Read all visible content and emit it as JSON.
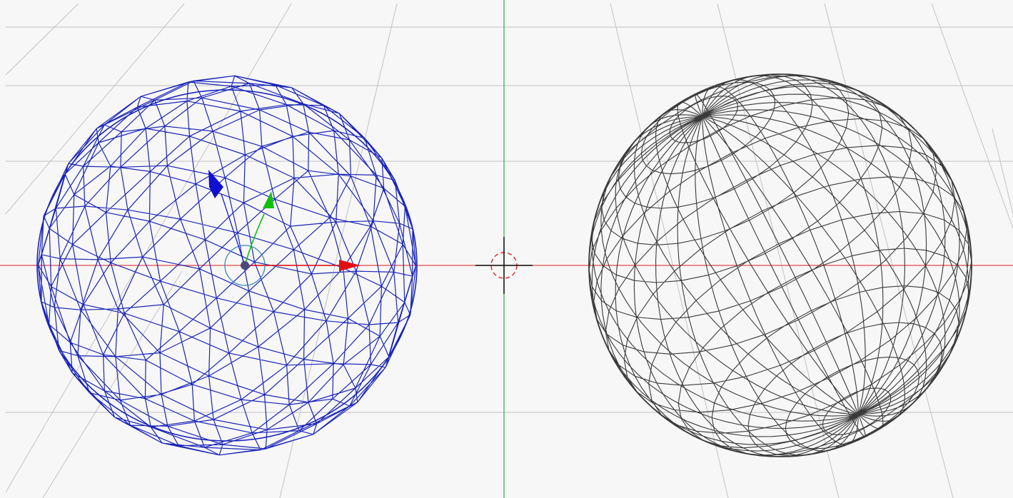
{
  "viewport": {
    "background": "#f7f7f7",
    "grid_color": "#c2c2c2",
    "grid_visible": true
  },
  "axes": {
    "x_axis_color": "#e04848",
    "y_axis_color": "#3cb84a"
  },
  "objects": [
    {
      "name": "icosphere",
      "mesh": "icosphere",
      "display": "wireframe",
      "selected": true,
      "color": "#1a25b8"
    },
    {
      "name": "uv-sphere",
      "mesh": "uv-sphere",
      "display": "wireframe",
      "selected": false,
      "color": "#3a3a3a"
    }
  ],
  "gizmo": {
    "mode": "translate",
    "x_color": "#e01010",
    "y_color": "#10c010",
    "z_color": "#1010d0",
    "origin_color": "#4a4a7a",
    "ring_color": "#3a8ab8"
  },
  "cursor": {
    "icon": "3d-cursor-icon",
    "ring_color": "#e03030",
    "cross_color": "#111111"
  }
}
